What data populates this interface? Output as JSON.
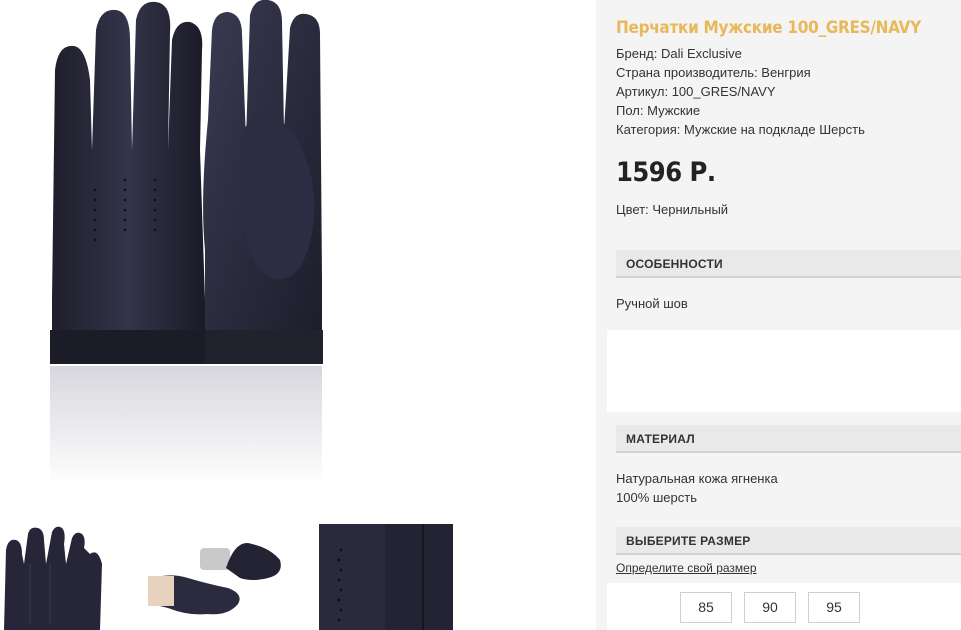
{
  "product": {
    "title": "Перчатки Мужские 100_GRES/NAVY",
    "brand": "Бренд: Dali Exclusive",
    "country": "Страна производитель: Венгрия",
    "article": "Артикул: 100_GRES/NAVY",
    "gender": "Пол: Мужские",
    "category": "Категория: Мужские на подкладе Шерсть",
    "price": "1596 Р.",
    "color": "Цвет: Чернильный"
  },
  "sections": {
    "features": {
      "heading": "ОСОБЕННОСТИ",
      "text": "Ручной шов"
    },
    "material": {
      "heading": "МАТЕРИАЛ",
      "line1": "Натуральная кожа ягненка",
      "line2": "100% шерсть"
    },
    "size": {
      "heading": "ВЫБЕРИТЕ РАЗМЕР",
      "link": "Определите свой размер",
      "options": [
        "85",
        "90",
        "95"
      ]
    }
  },
  "colors": {
    "title": "#e8b85a",
    "glove": "#262638",
    "panel": "#f4f4f4"
  },
  "gallery": {
    "main": "gloves-photo",
    "thumbs": [
      "gloves-pair-thumb",
      "gloves-worn-thumb",
      "glove-detail-thumb"
    ]
  }
}
